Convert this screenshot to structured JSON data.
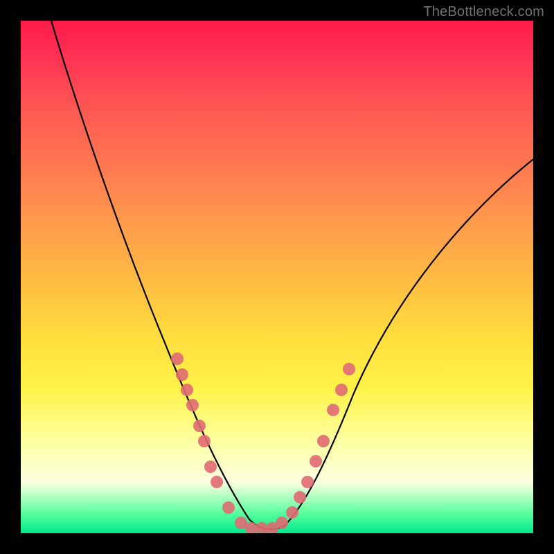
{
  "watermark": "TheBottleneck.com",
  "chart_data": {
    "type": "line",
    "title": "",
    "xlabel": "",
    "ylabel": "",
    "xlim": [
      0,
      100
    ],
    "ylim": [
      0,
      100
    ],
    "grid": false,
    "legend": false,
    "series": [
      {
        "name": "bottleneck-curve",
        "x": [
          6,
          10,
          15,
          20,
          25,
          30,
          33,
          36,
          38,
          40,
          42,
          44,
          46,
          48,
          50,
          53,
          56,
          60,
          65,
          70,
          75,
          80,
          85,
          90,
          95,
          100
        ],
        "y": [
          100,
          88,
          75,
          62,
          48,
          35,
          27,
          20,
          14,
          9,
          5,
          2,
          1,
          1,
          2,
          5,
          10,
          17,
          26,
          35,
          44,
          52,
          59,
          65,
          70,
          74
        ]
      }
    ],
    "scatter_overlay": {
      "name": "data-points",
      "points": [
        {
          "x": 30.5,
          "y": 34
        },
        {
          "x": 31.5,
          "y": 31
        },
        {
          "x": 32.5,
          "y": 28
        },
        {
          "x": 33.5,
          "y": 25
        },
        {
          "x": 34.8,
          "y": 21
        },
        {
          "x": 35.8,
          "y": 18
        },
        {
          "x": 37.0,
          "y": 13
        },
        {
          "x": 38.2,
          "y": 10
        },
        {
          "x": 40.5,
          "y": 5
        },
        {
          "x": 43.0,
          "y": 2
        },
        {
          "x": 45.0,
          "y": 1
        },
        {
          "x": 47.0,
          "y": 1
        },
        {
          "x": 49.0,
          "y": 1
        },
        {
          "x": 51.0,
          "y": 2
        },
        {
          "x": 53.0,
          "y": 4
        },
        {
          "x": 54.5,
          "y": 7
        },
        {
          "x": 56.0,
          "y": 10
        },
        {
          "x": 57.5,
          "y": 14
        },
        {
          "x": 59.0,
          "y": 18
        },
        {
          "x": 61.0,
          "y": 24
        },
        {
          "x": 62.5,
          "y": 28
        },
        {
          "x": 64.0,
          "y": 32
        }
      ]
    }
  }
}
